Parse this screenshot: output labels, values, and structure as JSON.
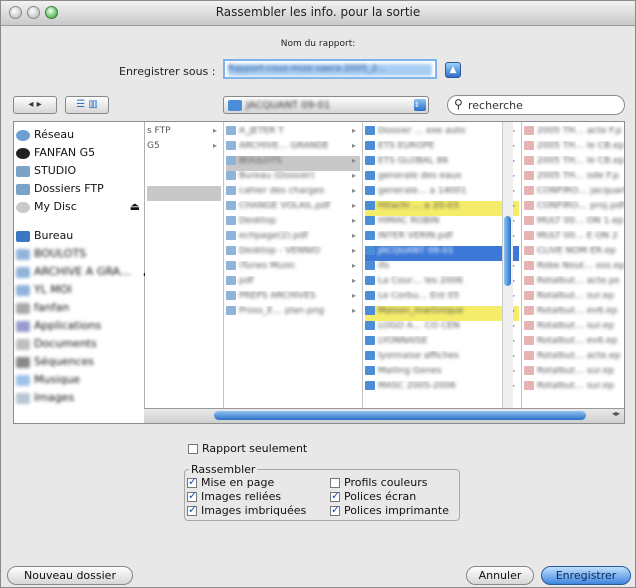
{
  "window": {
    "title": "Rassembler les info. pour la sortie",
    "report_name_label": "Nom du rapport:"
  },
  "save_as": {
    "label": "Enregistrer sous :",
    "value": "Rapport-cous-mize-saera-2005_2…"
  },
  "toolbar": {
    "location": "JACQUANT 09-01",
    "search_placeholder": "recherche"
  },
  "sidebar": {
    "devices": [
      {
        "label": "Réseau",
        "icon": "network-icon"
      },
      {
        "label": "FANFAN G5",
        "icon": "computer-icon"
      },
      {
        "label": "STUDIO",
        "icon": "network-share-icon"
      },
      {
        "label": "Dossiers FTP",
        "icon": "network-share-icon"
      },
      {
        "label": "My Disc",
        "icon": "disc-icon"
      }
    ],
    "places": [
      {
        "label": "Bureau",
        "icon": "desktop-icon"
      },
      {
        "label": "BOULOTS",
        "icon": "folder-icon"
      },
      {
        "label": "ARCHIVE A GRA…",
        "icon": "folder-icon"
      },
      {
        "label": "YL MOI",
        "icon": "folder-icon"
      },
      {
        "label": "fanfan",
        "icon": "home-icon"
      },
      {
        "label": "Applications",
        "icon": "applications-icon"
      },
      {
        "label": "Documents",
        "icon": "documents-icon"
      },
      {
        "label": "Séquences",
        "icon": "movies-icon"
      },
      {
        "label": "Musique",
        "icon": "music-icon"
      },
      {
        "label": "Images",
        "icon": "pictures-icon"
      }
    ]
  },
  "columns": {
    "col1": [
      "s FTP",
      "G5",
      "",
      "",
      ""
    ],
    "col2": [
      "A_JETER T",
      "ARCHIVE… GRANDE",
      "BOULOTS",
      "Bureau (Dossier)",
      "cahier des charges",
      "CHANGE VOLAIL.pdf",
      "Desktop",
      "echpage(2).pdf",
      "Desktop - VENNIO",
      "iTunes Music",
      "pdf",
      "PREPS ARCHIVES",
      "Pross_E… plan.png"
    ],
    "col3": [
      "Dossier … exe auto",
      "ETS EUROPE",
      "ETS GLOBAL 86",
      "generale des eaux",
      "generale… a 14001",
      "Hitachi … a 20-03",
      "HIMAC ROBIN",
      "INTER VERIN.pdf",
      "JACQUANT 09-01",
      "ifo",
      "La Cour… les 2006",
      "Le Corbu… Ent 05",
      "Maison_martinique",
      "LOGO A… CO CEN",
      "LYONNAISE",
      "lyonnaise affiches",
      "Mailing Genes",
      "MASC 2005-2006"
    ],
    "col4": [
      "2005 TH… acte F.p",
      "2005 TH… le CB.ep",
      "2005 TH… le CB.ep",
      "2005 TH… ode F.p",
      "CONFIRO… jacquart",
      "CONFIRO… proj.pdf",
      "MULT 00… ON 1.ep",
      "MULT 00… E ON 2",
      "CLIVE NOM ER.ep",
      "Robe Nout… oss.ep",
      "Rotalbut… acte.ps",
      "Rotalbut… sur.ep",
      "Rotalbut… ev6.ep",
      "Rotalbut… sur.ep",
      "Rotalbut… ev6.ep",
      "Rotalbut… acte.ep",
      "Rotalbut… sur.ep",
      "Rotalbut… sur.ep"
    ]
  },
  "options": {
    "report_only": {
      "label": "Rapport seulement",
      "checked": false
    },
    "group_label": "Rassembler",
    "layout": {
      "label": "Mise en page",
      "checked": true
    },
    "linked_images": {
      "label": "Images reliées",
      "checked": true
    },
    "embedded_images": {
      "label": "Images imbriquées",
      "checked": true
    },
    "color_profiles": {
      "label": "Profils couleurs",
      "checked": false
    },
    "screen_fonts": {
      "label": "Polices écran",
      "checked": true
    },
    "printer_fonts": {
      "label": "Polices imprimante",
      "checked": true
    }
  },
  "buttons": {
    "new_folder": "Nouveau dossier",
    "cancel": "Annuler",
    "save": "Enregistrer"
  },
  "colors": {
    "accent": "#2d6fc7",
    "selection": "#3c78d8",
    "highlight": "#f5ec6a"
  }
}
